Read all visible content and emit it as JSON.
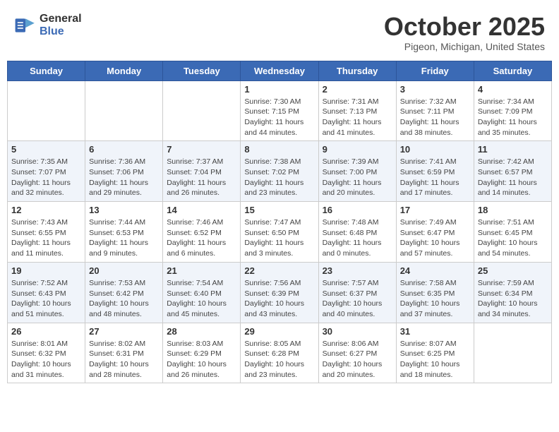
{
  "header": {
    "logo_general": "General",
    "logo_blue": "Blue",
    "month_title": "October 2025",
    "subtitle": "Pigeon, Michigan, United States"
  },
  "weekdays": [
    "Sunday",
    "Monday",
    "Tuesday",
    "Wednesday",
    "Thursday",
    "Friday",
    "Saturday"
  ],
  "weeks": [
    [
      {
        "day": "",
        "sunrise": "",
        "sunset": "",
        "daylight": ""
      },
      {
        "day": "",
        "sunrise": "",
        "sunset": "",
        "daylight": ""
      },
      {
        "day": "",
        "sunrise": "",
        "sunset": "",
        "daylight": ""
      },
      {
        "day": "1",
        "sunrise": "Sunrise: 7:30 AM",
        "sunset": "Sunset: 7:15 PM",
        "daylight": "Daylight: 11 hours and 44 minutes."
      },
      {
        "day": "2",
        "sunrise": "Sunrise: 7:31 AM",
        "sunset": "Sunset: 7:13 PM",
        "daylight": "Daylight: 11 hours and 41 minutes."
      },
      {
        "day": "3",
        "sunrise": "Sunrise: 7:32 AM",
        "sunset": "Sunset: 7:11 PM",
        "daylight": "Daylight: 11 hours and 38 minutes."
      },
      {
        "day": "4",
        "sunrise": "Sunrise: 7:34 AM",
        "sunset": "Sunset: 7:09 PM",
        "daylight": "Daylight: 11 hours and 35 minutes."
      }
    ],
    [
      {
        "day": "5",
        "sunrise": "Sunrise: 7:35 AM",
        "sunset": "Sunset: 7:07 PM",
        "daylight": "Daylight: 11 hours and 32 minutes."
      },
      {
        "day": "6",
        "sunrise": "Sunrise: 7:36 AM",
        "sunset": "Sunset: 7:06 PM",
        "daylight": "Daylight: 11 hours and 29 minutes."
      },
      {
        "day": "7",
        "sunrise": "Sunrise: 7:37 AM",
        "sunset": "Sunset: 7:04 PM",
        "daylight": "Daylight: 11 hours and 26 minutes."
      },
      {
        "day": "8",
        "sunrise": "Sunrise: 7:38 AM",
        "sunset": "Sunset: 7:02 PM",
        "daylight": "Daylight: 11 hours and 23 minutes."
      },
      {
        "day": "9",
        "sunrise": "Sunrise: 7:39 AM",
        "sunset": "Sunset: 7:00 PM",
        "daylight": "Daylight: 11 hours and 20 minutes."
      },
      {
        "day": "10",
        "sunrise": "Sunrise: 7:41 AM",
        "sunset": "Sunset: 6:59 PM",
        "daylight": "Daylight: 11 hours and 17 minutes."
      },
      {
        "day": "11",
        "sunrise": "Sunrise: 7:42 AM",
        "sunset": "Sunset: 6:57 PM",
        "daylight": "Daylight: 11 hours and 14 minutes."
      }
    ],
    [
      {
        "day": "12",
        "sunrise": "Sunrise: 7:43 AM",
        "sunset": "Sunset: 6:55 PM",
        "daylight": "Daylight: 11 hours and 11 minutes."
      },
      {
        "day": "13",
        "sunrise": "Sunrise: 7:44 AM",
        "sunset": "Sunset: 6:53 PM",
        "daylight": "Daylight: 11 hours and 9 minutes."
      },
      {
        "day": "14",
        "sunrise": "Sunrise: 7:46 AM",
        "sunset": "Sunset: 6:52 PM",
        "daylight": "Daylight: 11 hours and 6 minutes."
      },
      {
        "day": "15",
        "sunrise": "Sunrise: 7:47 AM",
        "sunset": "Sunset: 6:50 PM",
        "daylight": "Daylight: 11 hours and 3 minutes."
      },
      {
        "day": "16",
        "sunrise": "Sunrise: 7:48 AM",
        "sunset": "Sunset: 6:48 PM",
        "daylight": "Daylight: 11 hours and 0 minutes."
      },
      {
        "day": "17",
        "sunrise": "Sunrise: 7:49 AM",
        "sunset": "Sunset: 6:47 PM",
        "daylight": "Daylight: 10 hours and 57 minutes."
      },
      {
        "day": "18",
        "sunrise": "Sunrise: 7:51 AM",
        "sunset": "Sunset: 6:45 PM",
        "daylight": "Daylight: 10 hours and 54 minutes."
      }
    ],
    [
      {
        "day": "19",
        "sunrise": "Sunrise: 7:52 AM",
        "sunset": "Sunset: 6:43 PM",
        "daylight": "Daylight: 10 hours and 51 minutes."
      },
      {
        "day": "20",
        "sunrise": "Sunrise: 7:53 AM",
        "sunset": "Sunset: 6:42 PM",
        "daylight": "Daylight: 10 hours and 48 minutes."
      },
      {
        "day": "21",
        "sunrise": "Sunrise: 7:54 AM",
        "sunset": "Sunset: 6:40 PM",
        "daylight": "Daylight: 10 hours and 45 minutes."
      },
      {
        "day": "22",
        "sunrise": "Sunrise: 7:56 AM",
        "sunset": "Sunset: 6:39 PM",
        "daylight": "Daylight: 10 hours and 43 minutes."
      },
      {
        "day": "23",
        "sunrise": "Sunrise: 7:57 AM",
        "sunset": "Sunset: 6:37 PM",
        "daylight": "Daylight: 10 hours and 40 minutes."
      },
      {
        "day": "24",
        "sunrise": "Sunrise: 7:58 AM",
        "sunset": "Sunset: 6:35 PM",
        "daylight": "Daylight: 10 hours and 37 minutes."
      },
      {
        "day": "25",
        "sunrise": "Sunrise: 7:59 AM",
        "sunset": "Sunset: 6:34 PM",
        "daylight": "Daylight: 10 hours and 34 minutes."
      }
    ],
    [
      {
        "day": "26",
        "sunrise": "Sunrise: 8:01 AM",
        "sunset": "Sunset: 6:32 PM",
        "daylight": "Daylight: 10 hours and 31 minutes."
      },
      {
        "day": "27",
        "sunrise": "Sunrise: 8:02 AM",
        "sunset": "Sunset: 6:31 PM",
        "daylight": "Daylight: 10 hours and 28 minutes."
      },
      {
        "day": "28",
        "sunrise": "Sunrise: 8:03 AM",
        "sunset": "Sunset: 6:29 PM",
        "daylight": "Daylight: 10 hours and 26 minutes."
      },
      {
        "day": "29",
        "sunrise": "Sunrise: 8:05 AM",
        "sunset": "Sunset: 6:28 PM",
        "daylight": "Daylight: 10 hours and 23 minutes."
      },
      {
        "day": "30",
        "sunrise": "Sunrise: 8:06 AM",
        "sunset": "Sunset: 6:27 PM",
        "daylight": "Daylight: 10 hours and 20 minutes."
      },
      {
        "day": "31",
        "sunrise": "Sunrise: 8:07 AM",
        "sunset": "Sunset: 6:25 PM",
        "daylight": "Daylight: 10 hours and 18 minutes."
      },
      {
        "day": "",
        "sunrise": "",
        "sunset": "",
        "daylight": ""
      }
    ]
  ]
}
